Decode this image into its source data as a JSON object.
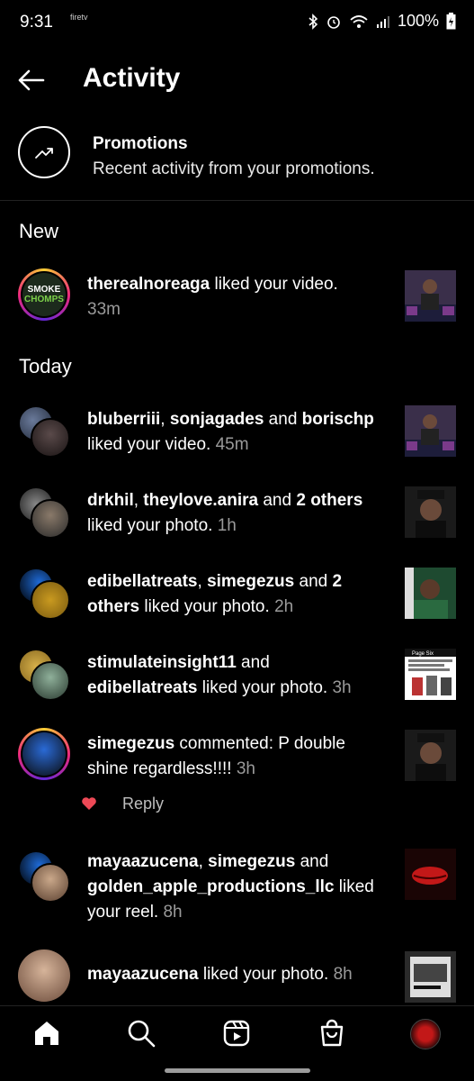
{
  "status": {
    "time": "9:31",
    "brand": "firetv",
    "battery": "100%"
  },
  "header": {
    "title": "Activity"
  },
  "promotions": {
    "title": "Promotions",
    "subtitle": "Recent activity from your promotions."
  },
  "sections": {
    "new": "New",
    "today": "Today"
  },
  "items": [
    {
      "user1": "therealnoreaga",
      "mid": " liked your video. ",
      "time": "33m"
    },
    {
      "user1": "bluberriii",
      "sep1": ", ",
      "user2": "sonjagades",
      "sep2": " and ",
      "user3": "borischp",
      "mid": " liked your video. ",
      "time": "45m"
    },
    {
      "user1": "drkhil",
      "sep1": ", ",
      "user2": "theylove.anira",
      "sep2": " and ",
      "user3": "2 others",
      "mid": " liked your photo. ",
      "time": "1h"
    },
    {
      "user1": "edibellatreats",
      "sep1": ", ",
      "user2": "simegezus",
      "sep2": " and ",
      "user3": "2 others",
      "mid": " liked your photo. ",
      "time": "2h"
    },
    {
      "user1": "stimulateinsight11",
      "sep1": " and ",
      "user2": "edibellatreats",
      "mid": " liked your photo. ",
      "time": "3h"
    },
    {
      "user1": "simegezus",
      "mid": " commented: P double shine regardless!!!! ",
      "time": "3h"
    },
    {
      "user1": "mayaazucena",
      "sep1": ", ",
      "user2": "simegezus",
      "sep2": " and ",
      "user3": "golden_apple_productions_llc",
      "mid": " liked your reel. ",
      "time": "8h"
    },
    {
      "user1": "mayaazucena",
      "mid": " liked your photo. ",
      "time": "8h"
    }
  ],
  "reply": {
    "label": "Reply"
  },
  "logo_text": {
    "line1": "SMOKE",
    "line2": "CHOMPS"
  },
  "thumb_text": {
    "page_six": "Page Six"
  },
  "colors": {
    "heart": "#ed4956",
    "accent": "#ffffff",
    "muted": "#9a9a9a"
  },
  "nav": {
    "items": [
      "home-icon",
      "search-icon",
      "reels-icon",
      "shop-icon",
      "profile-avatar"
    ]
  }
}
